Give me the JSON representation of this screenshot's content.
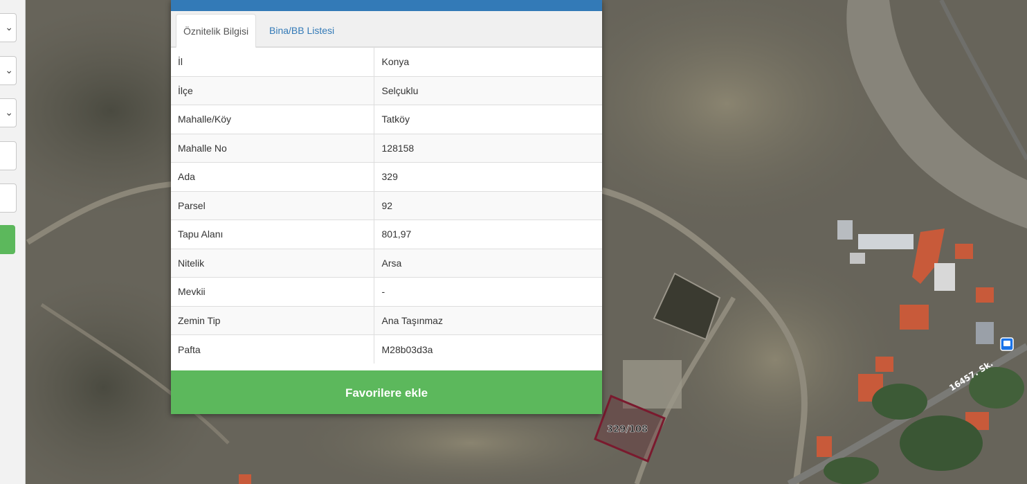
{
  "tabs": [
    {
      "label": "Öznitelik Bilgisi",
      "active": true
    },
    {
      "label": "Bina/BB Listesi",
      "active": false
    }
  ],
  "attributes": [
    {
      "key": "İl",
      "value": "Konya"
    },
    {
      "key": "İlçe",
      "value": "Selçuklu"
    },
    {
      "key": "Mahalle/Köy",
      "value": "Tatköy"
    },
    {
      "key": "Mahalle No",
      "value": "128158"
    },
    {
      "key": "Ada",
      "value": "329"
    },
    {
      "key": "Parsel",
      "value": "92"
    },
    {
      "key": "Tapu Alanı",
      "value": "801,97"
    },
    {
      "key": "Nitelik",
      "value": "Arsa"
    },
    {
      "key": "Mevkii",
      "value": "-"
    },
    {
      "key": "Zemin Tip",
      "value": "Ana Taşınmaz"
    },
    {
      "key": "Pafta",
      "value": "M28b03d3a"
    }
  ],
  "favorite_button": "Favorilere ekle",
  "map": {
    "parcel_label": "329/108",
    "street_label": "16457. Sk.",
    "bus_stop_icon": "bus-stop-icon"
  },
  "colors": {
    "header": "#337ab7",
    "button_green": "#5cb85c",
    "tab_link": "#337ab7",
    "parcel_outline": "#7a1a2e"
  }
}
